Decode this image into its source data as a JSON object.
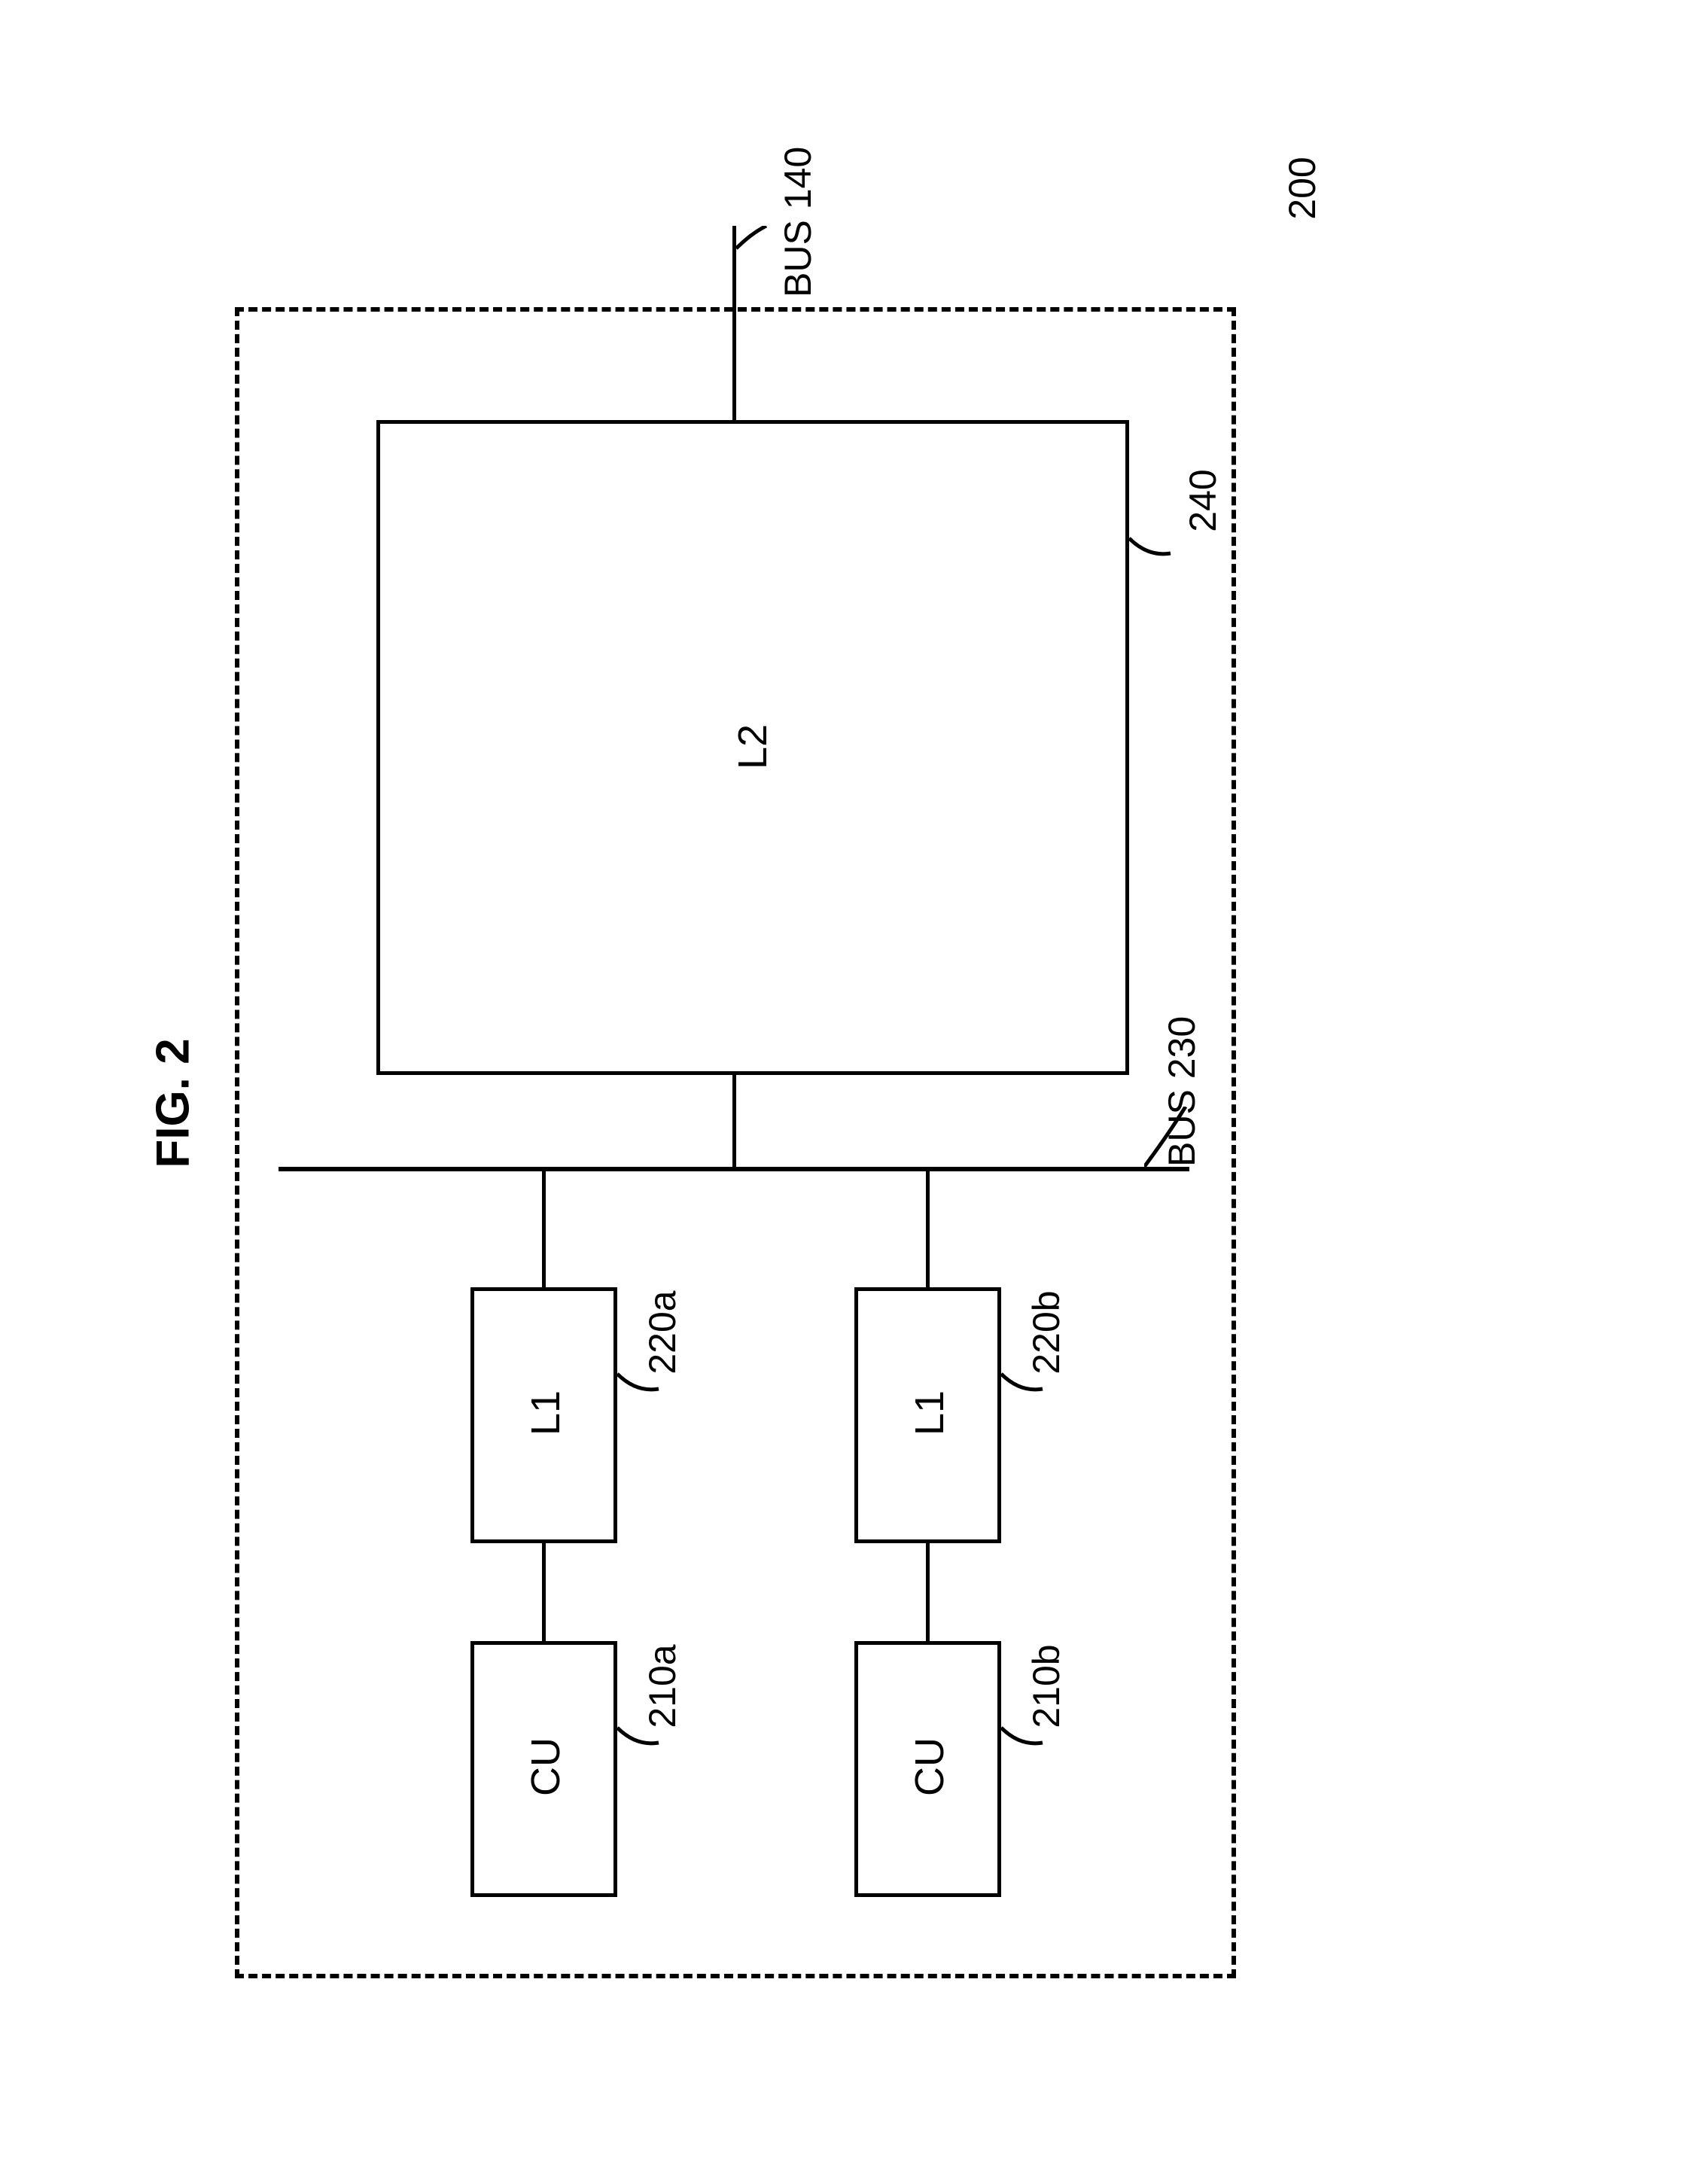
{
  "figure_label": "FIG. 2",
  "module_ref": "200",
  "bus_external": "BUS 140",
  "bus_internal": "BUS 230",
  "l2": {
    "text": "L2",
    "ref": "240"
  },
  "l1a": {
    "text": "L1",
    "ref": "220a"
  },
  "l1b": {
    "text": "L1",
    "ref": "220b"
  },
  "cua": {
    "text": "CU",
    "ref": "210a"
  },
  "cub": {
    "text": "CU",
    "ref": "210b"
  }
}
